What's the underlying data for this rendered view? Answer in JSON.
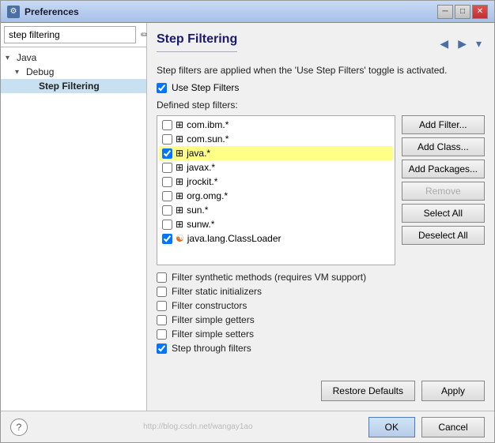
{
  "window": {
    "title": "Preferences",
    "icon": "⚙",
    "min_btn": "─",
    "max_btn": "□",
    "close_btn": "✕"
  },
  "sidebar": {
    "search_placeholder": "step filtering",
    "clear_icon": "✏",
    "tree": [
      {
        "label": "Java",
        "indent": 0,
        "arrow": "▾",
        "bold": false
      },
      {
        "label": "Debug",
        "indent": 1,
        "arrow": "▾",
        "bold": false
      },
      {
        "label": "Step Filtering",
        "indent": 2,
        "arrow": "",
        "bold": true,
        "selected": true
      }
    ]
  },
  "main": {
    "title": "Step Filtering",
    "nav_back": "◀",
    "nav_fwd": "▶",
    "nav_menu": "▾",
    "description": "Step filters are applied when the 'Use Step Filters' toggle is activated.",
    "use_step_filters_label": "Use Step Filters",
    "use_step_filters_checked": true,
    "defined_filters_label": "Defined step filters:",
    "filters": [
      {
        "text": "com.ibm.*",
        "checked": false,
        "icon": "⊞",
        "highlighted": false
      },
      {
        "text": "com.sun.*",
        "checked": false,
        "icon": "⊞",
        "highlighted": false
      },
      {
        "text": "java.*",
        "checked": true,
        "icon": "⊞",
        "highlighted": true
      },
      {
        "text": "javax.*",
        "checked": false,
        "icon": "⊞",
        "highlighted": false
      },
      {
        "text": "jrockit.*",
        "checked": false,
        "icon": "⊞",
        "highlighted": false
      },
      {
        "text": "org.omg.*",
        "checked": false,
        "icon": "⊞",
        "highlighted": false
      },
      {
        "text": "sun.*",
        "checked": false,
        "icon": "⊞",
        "highlighted": false
      },
      {
        "text": "sunw.*",
        "checked": false,
        "icon": "⊞",
        "highlighted": false
      },
      {
        "text": "java.lang.ClassLoader",
        "checked": true,
        "icon": "☯",
        "highlighted": false,
        "icon_class": "java-loader-icon"
      }
    ],
    "filter_buttons": [
      {
        "label": "Add Filter...",
        "disabled": false,
        "name": "add-filter-button"
      },
      {
        "label": "Add Class...",
        "disabled": false,
        "name": "add-class-button"
      },
      {
        "label": "Add Packages...",
        "disabled": false,
        "name": "add-packages-button"
      },
      {
        "label": "Remove",
        "disabled": true,
        "name": "remove-button"
      },
      {
        "label": "Select All",
        "disabled": false,
        "name": "select-all-button"
      },
      {
        "label": "Deselect All",
        "disabled": false,
        "name": "deselect-all-button"
      }
    ],
    "options": [
      {
        "label": "Filter synthetic methods (requires VM support)",
        "checked": false,
        "name": "filter-synthetic-checkbox"
      },
      {
        "label": "Filter static initializers",
        "checked": false,
        "name": "filter-static-checkbox"
      },
      {
        "label": "Filter constructors",
        "checked": false,
        "name": "filter-constructors-checkbox"
      },
      {
        "label": "Filter simple getters",
        "checked": false,
        "name": "filter-getters-checkbox"
      },
      {
        "label": "Filter simple setters",
        "checked": false,
        "name": "filter-setters-checkbox"
      },
      {
        "label": "Step through filters",
        "checked": true,
        "name": "step-through-checkbox"
      }
    ],
    "bottom_buttons": [
      {
        "label": "Restore Defaults",
        "name": "restore-defaults-button"
      },
      {
        "label": "Apply",
        "name": "apply-button"
      }
    ]
  },
  "footer": {
    "help_icon": "?",
    "ok_label": "OK",
    "cancel_label": "Cancel"
  }
}
